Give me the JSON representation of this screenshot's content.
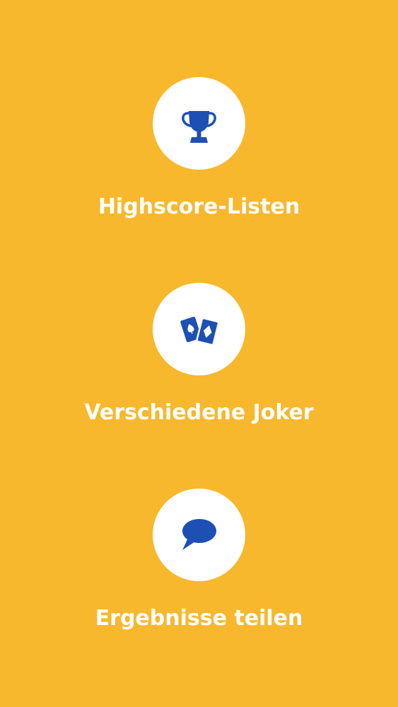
{
  "colors": {
    "background": "#F7B82D",
    "circle": "#FFFFFF",
    "icon": "#1E4FB5",
    "label": "#FFFFFF"
  },
  "features": [
    {
      "icon": "trophy-icon",
      "label": "Highscore-Listen"
    },
    {
      "icon": "playing-cards-icon",
      "label": "Verschiedene Joker"
    },
    {
      "icon": "speech-bubble-icon",
      "label": "Ergebnisse teilen"
    }
  ]
}
